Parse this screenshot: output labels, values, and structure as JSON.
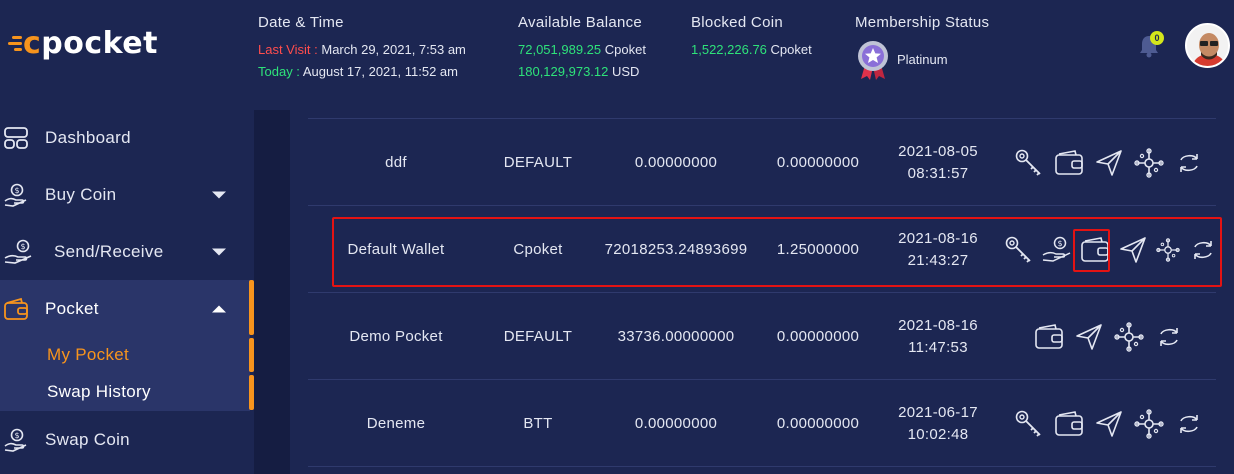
{
  "brand": {
    "logo_prefix": "c",
    "logo_rest": "pocket"
  },
  "header": {
    "datetime": {
      "title": "Date & Time",
      "last_visit_label": "Last Visit :",
      "last_visit_value": "March 29, 2021, 7:53 am",
      "today_label": "Today :",
      "today_value": "August 17, 2021, 11:52 am"
    },
    "balance": {
      "title": "Available Balance",
      "coin_amount": "72,051,989.25",
      "coin_unit": "Cpoket",
      "usd_amount": "180,129,973.12",
      "usd_unit": "USD"
    },
    "blocked": {
      "title": "Blocked Coin",
      "amount": "1,522,226.76",
      "unit": "Cpoket"
    },
    "membership": {
      "title": "Membership Status",
      "level": "Platinum"
    },
    "notification_count": "0"
  },
  "sidebar": {
    "items": [
      {
        "label": "Dashboard"
      },
      {
        "label": "Buy Coin"
      },
      {
        "label": "Send/Receive"
      },
      {
        "label": "Pocket"
      },
      {
        "label": "Swap Coin"
      }
    ],
    "pocket_sub": [
      {
        "label": "My Pocket"
      },
      {
        "label": "Swap History"
      }
    ]
  },
  "wallets": {
    "rows": [
      {
        "name": "ddf",
        "coin": "DEFAULT",
        "balance": "0.00000000",
        "referral": "0.00000000",
        "date": "2021-08-05",
        "time": "08:31:57"
      },
      {
        "name": "Default Wallet",
        "coin": "Cpoket",
        "balance": "72018253.24893699",
        "referral": "1.25000000",
        "date": "2021-08-16",
        "time": "21:43:27"
      },
      {
        "name": "Demo Pocket",
        "coin": "DEFAULT",
        "balance": "33736.00000000",
        "referral": "0.00000000",
        "date": "2021-08-16",
        "time": "11:47:53"
      },
      {
        "name": "Deneme",
        "coin": "BTT",
        "balance": "0.00000000",
        "referral": "0.00000000",
        "date": "2021-06-17",
        "time": "10:02:48"
      }
    ]
  },
  "colors": {
    "accent": "#f7941d",
    "highlight": "#e31313",
    "positive": "#2ee27a",
    "negative": "#ff4d4d",
    "background": "#1c2652"
  }
}
